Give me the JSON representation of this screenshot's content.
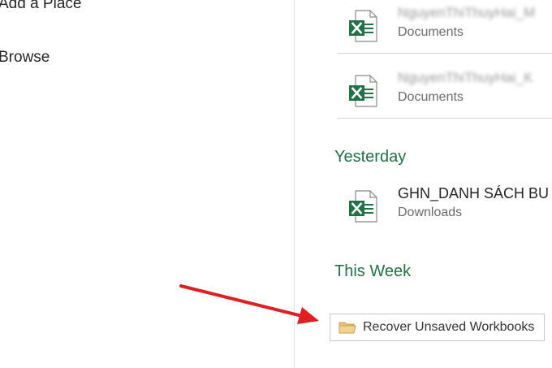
{
  "nav": {
    "add_place": "Add a Place",
    "browse": "Browse"
  },
  "recent": {
    "today_items": [
      {
        "name": "NguyenThiThuyHai_M",
        "location": "Documents"
      },
      {
        "name": "NguyenThiThuyHai_K",
        "location": "Documents"
      }
    ],
    "yesterday_heading": "Yesterday",
    "yesterday_items": [
      {
        "name": "GHN_DANH SÁCH BU",
        "location": "Downloads"
      }
    ],
    "this_week_heading": "This Week"
  },
  "recover": {
    "label": "Recover Unsaved Workbooks"
  },
  "colors": {
    "excel_green": "#217346",
    "annotation_red": "#e02020"
  },
  "icons": {
    "file": "excel-file-icon",
    "folder": "folder-icon"
  }
}
